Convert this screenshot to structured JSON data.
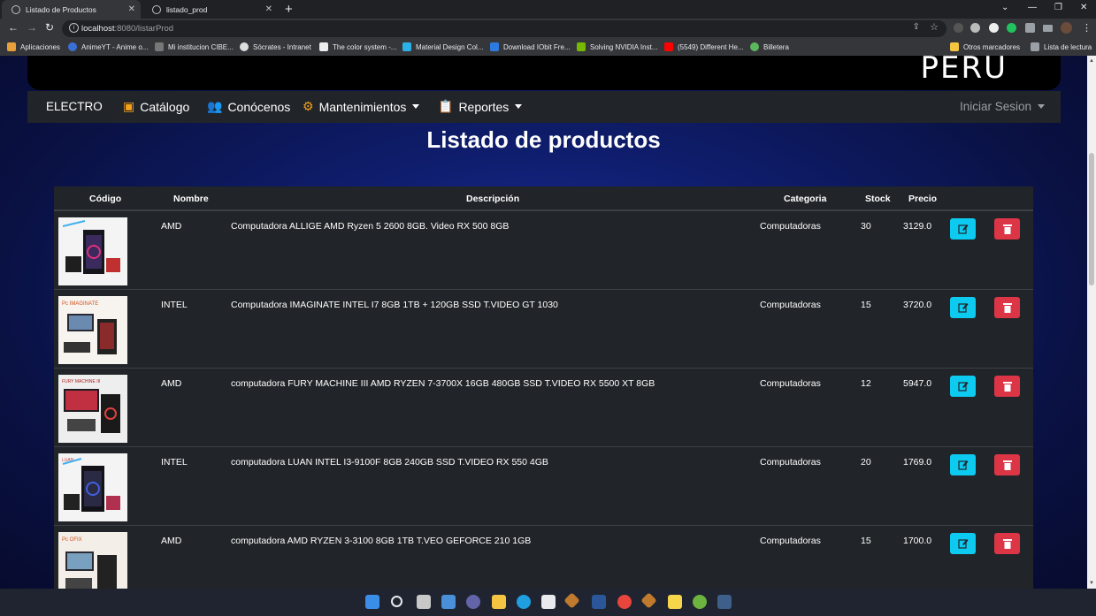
{
  "browser": {
    "tabs": [
      {
        "title": "Listado de Productos",
        "active": true
      },
      {
        "title": "listado_prod",
        "active": false
      }
    ],
    "url_host": "localhost",
    "url_path": ":8080/listarProd",
    "bookmarks": [
      "Aplicaciones",
      "AnimeYT - Anime o...",
      "Mi institucion CIBE...",
      "Sócrates - Intranet",
      "The color system -...",
      "Material Design Col...",
      "Download IObit Fre...",
      "Solving NVIDIA Inst...",
      "(5549) Different He...",
      "Billetera"
    ],
    "other_bookmarks": "Otros marcadores",
    "reading_list": "Lista de lectura"
  },
  "banner": {
    "text": "PERU"
  },
  "navbar": {
    "brand": "ELECTRO",
    "catalog": "Catálogo",
    "about": "Conócenos",
    "maintenance": "Mantenimientos",
    "reports": "Reportes",
    "login": "Iniciar Sesion"
  },
  "page": {
    "title": "Listado de productos"
  },
  "table": {
    "headers": {
      "code": "Código",
      "name": "Nombre",
      "description": "Descripción",
      "category": "Categoria",
      "stock": "Stock",
      "price": "Precio"
    },
    "rows": [
      {
        "name": "AMD",
        "description": "Computadora ALLIGE AMD Ryzen 5 2600 8GB. Video RX 500 8GB",
        "category": "Computadoras",
        "stock": "30",
        "price": "3129.0",
        "img_label": "ALLIGE"
      },
      {
        "name": "INTEL",
        "description": "Computadora IMAGINATE INTEL I7 8GB 1TB + 120GB SSD T.VIDEO GT 1030",
        "category": "Computadoras",
        "stock": "15",
        "price": "3720.0",
        "img_label": "Pc IMAGINATE"
      },
      {
        "name": "AMD",
        "description": "computadora FURY MACHINE III AMD RYZEN 7-3700X 16GB 480GB SSD T.VIDEO RX 5500 XT 8GB",
        "category": "Computadoras",
        "stock": "12",
        "price": "5947.0",
        "img_label": "FURY MACHINE III"
      },
      {
        "name": "INTEL",
        "description": "computadora LUAN INTEL I3-9100F 8GB 240GB SSD T.VIDEO RX 550 4GB",
        "category": "Computadoras",
        "stock": "20",
        "price": "1769.0",
        "img_label": "LUAN"
      },
      {
        "name": "AMD",
        "description": "computadora AMD RYZEN 3-3100 8GB 1TB T.VEO GEFORCE 210 1GB",
        "category": "Computadoras",
        "stock": "15",
        "price": "1700.0",
        "img_label": "Pc OFIX"
      }
    ]
  },
  "colors": {
    "edit_button": "#0dcaf0",
    "delete_button": "#dc3545",
    "navbar_bg": "#212529",
    "icon_accent": "#f6a21a"
  }
}
